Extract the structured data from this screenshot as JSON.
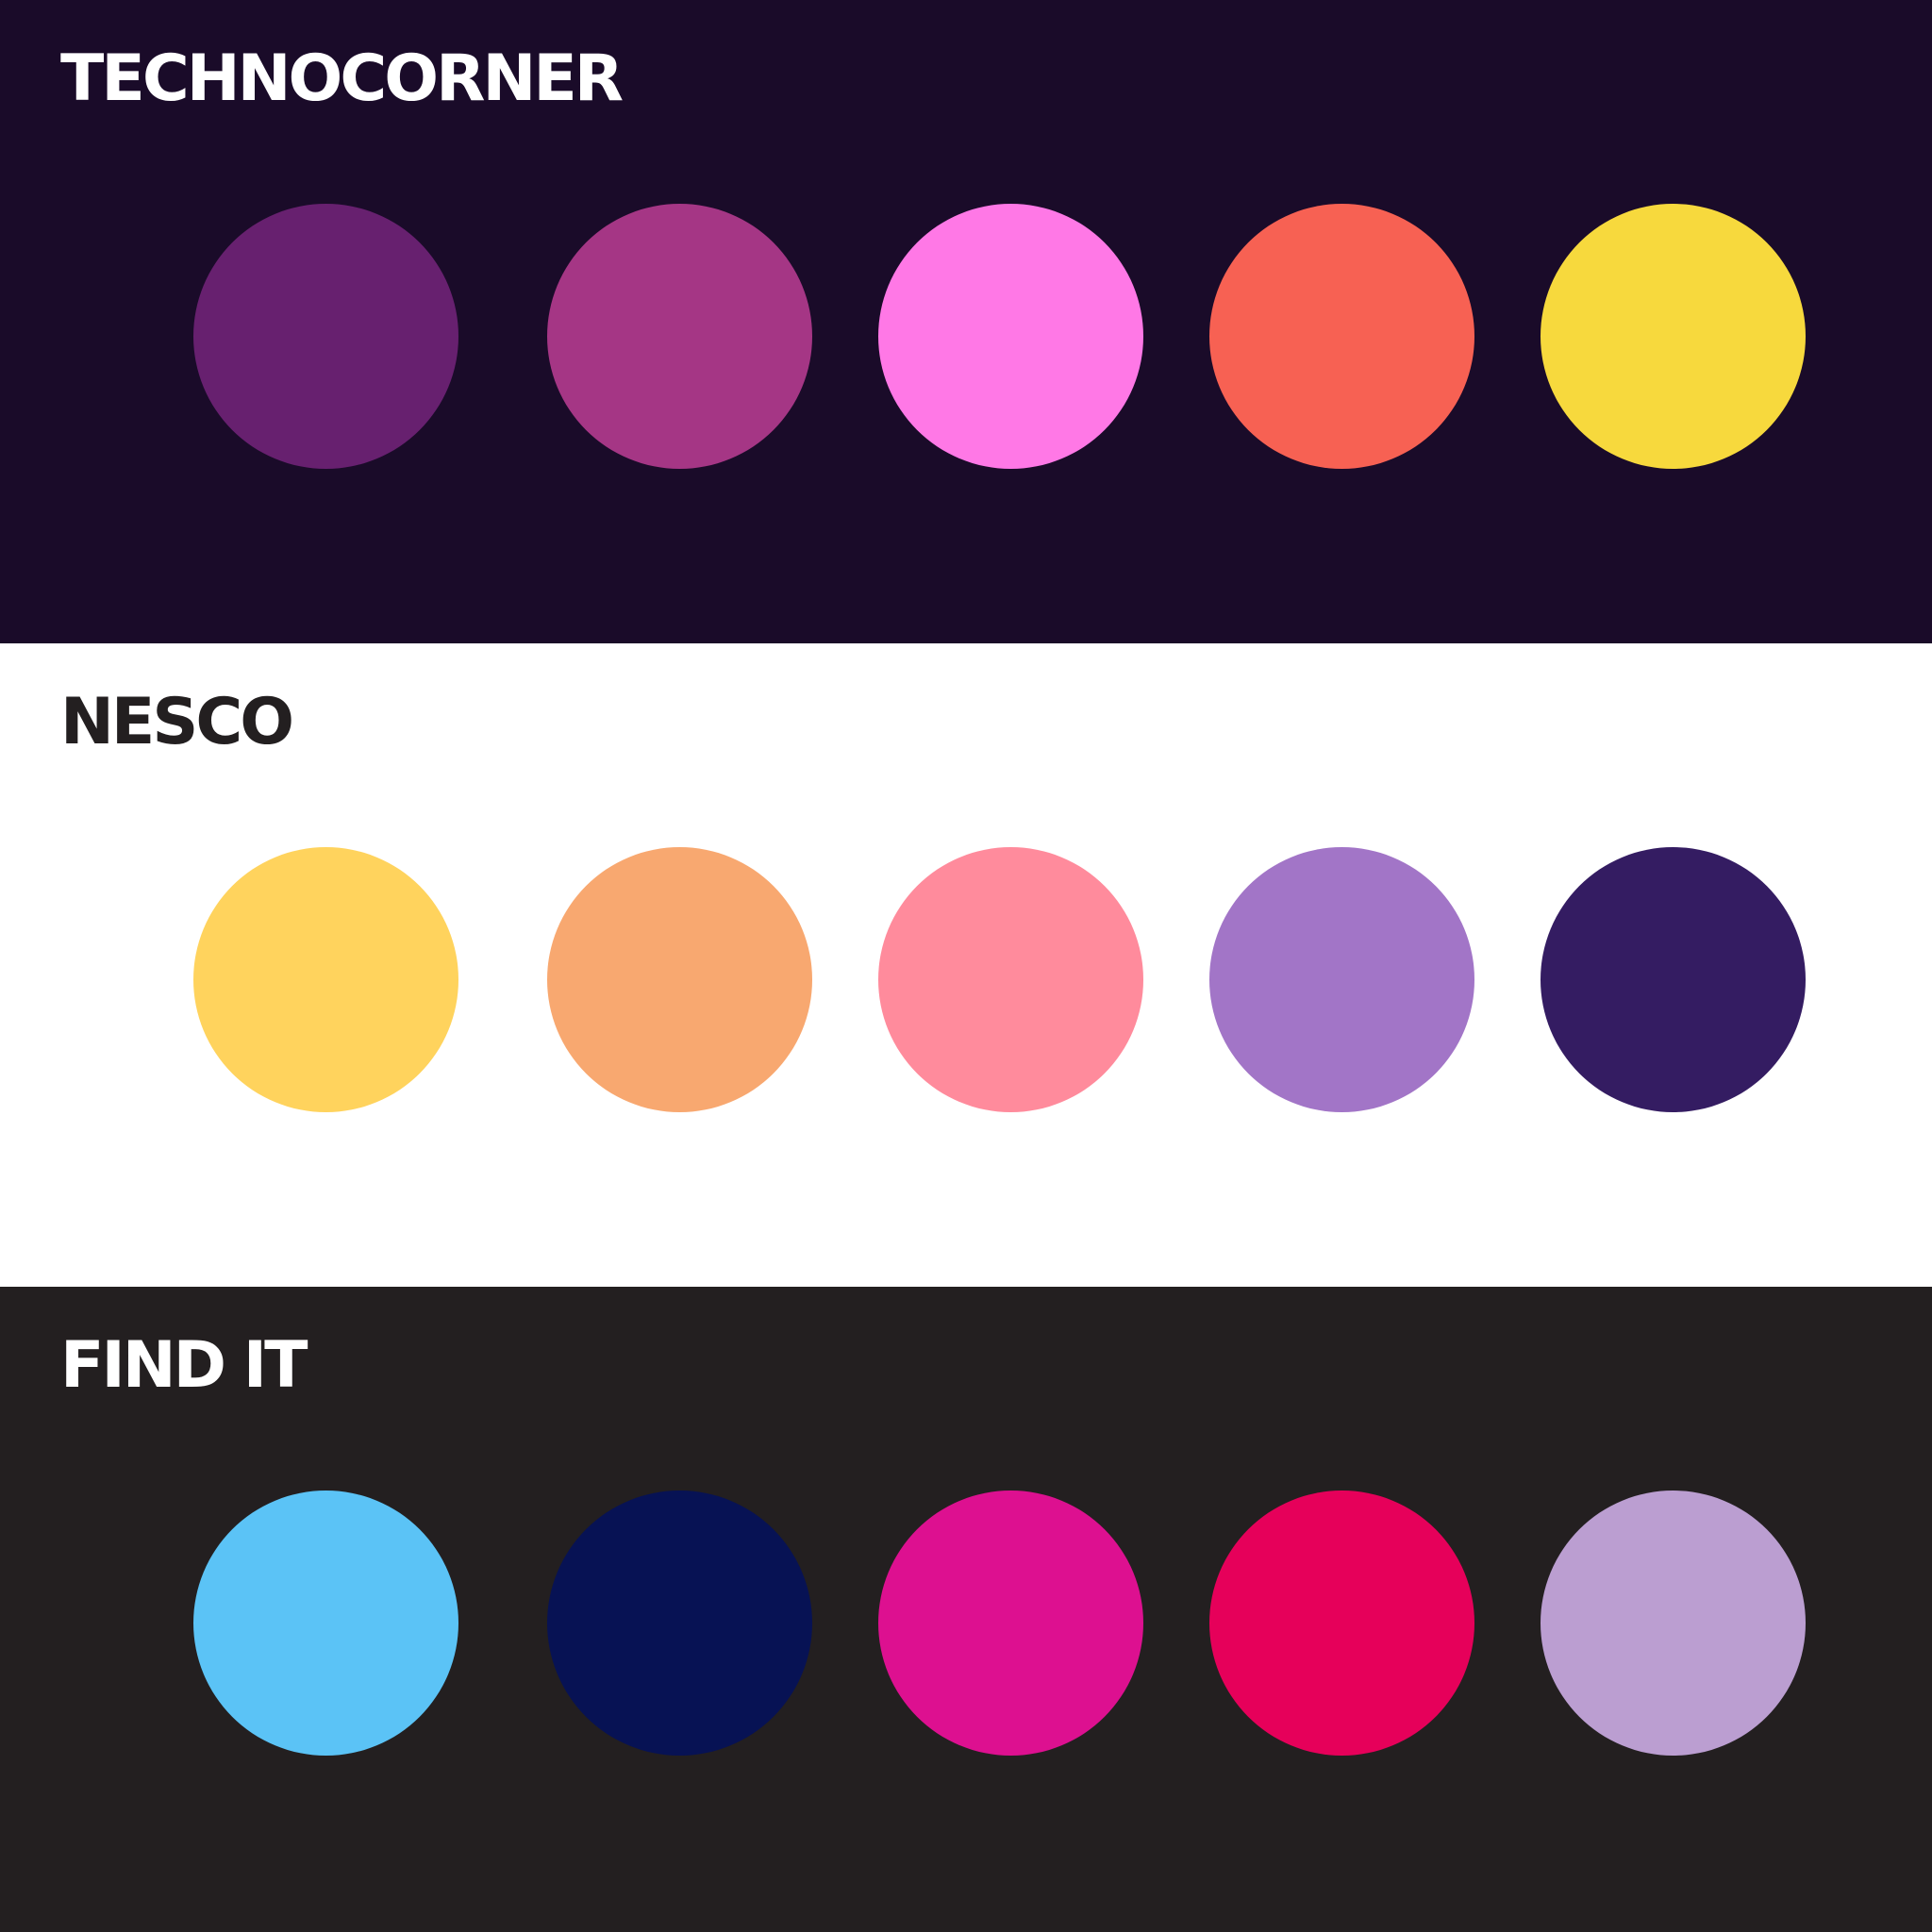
{
  "palettes": [
    {
      "name": "TECHNOCORNER",
      "background": "#1a0b29",
      "text_color": "#ffffff",
      "swatches": [
        "#67206f",
        "#a53685",
        "#ff78e6",
        "#f76153",
        "#f7d93d"
      ]
    },
    {
      "name": "NESCO",
      "background": "#ffffff",
      "text_color": "#231f20",
      "swatches": [
        "#ffd35d",
        "#f8a870",
        "#ff8b9c",
        "#a275c7",
        "#341c62"
      ]
    },
    {
      "name": "FIND IT",
      "background": "#231f20",
      "text_color": "#ffffff",
      "swatches": [
        "#5bc3f6",
        "#071254",
        "#dd1090",
        "#e6005a",
        "#bb9ed1"
      ]
    }
  ]
}
